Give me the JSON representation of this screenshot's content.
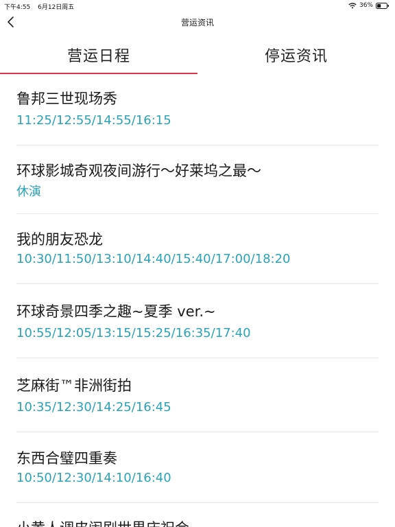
{
  "status_bar": {
    "time": "下午4:55",
    "date": "6月12日周五",
    "battery": "36%"
  },
  "nav": {
    "title": "营运资讯"
  },
  "tabs": [
    {
      "label": "营运日程",
      "selected": true
    },
    {
      "label": "停运资讯",
      "selected": false
    }
  ],
  "colors": {
    "accent": "#d9344a",
    "time_text": "#2aa3b7"
  },
  "shows": [
    {
      "title": "鲁邦三世现场秀",
      "times": "11:25/12:55/14:55/16:15"
    },
    {
      "title": "环球影城奇观夜间游行～好莱坞之最～",
      "times": "休演"
    },
    {
      "title": "我的朋友恐龙",
      "times": "10:30/11:50/13:10/14:40/15:40/17:00/18:20"
    },
    {
      "title": "环球奇景四季之趣~夏季 ver.~",
      "times": "10:55/12:05/13:15/15:25/16:35/17:40"
    },
    {
      "title": "芝麻街™非洲街拍",
      "times": "10:35/12:30/14:25/16:45"
    },
    {
      "title": "东西合璧四重奏",
      "times": "10:50/12:30/14:10/16:40"
    },
    {
      "title": "小黄人调皮闹剧世界庆祝会",
      "times": ""
    }
  ]
}
